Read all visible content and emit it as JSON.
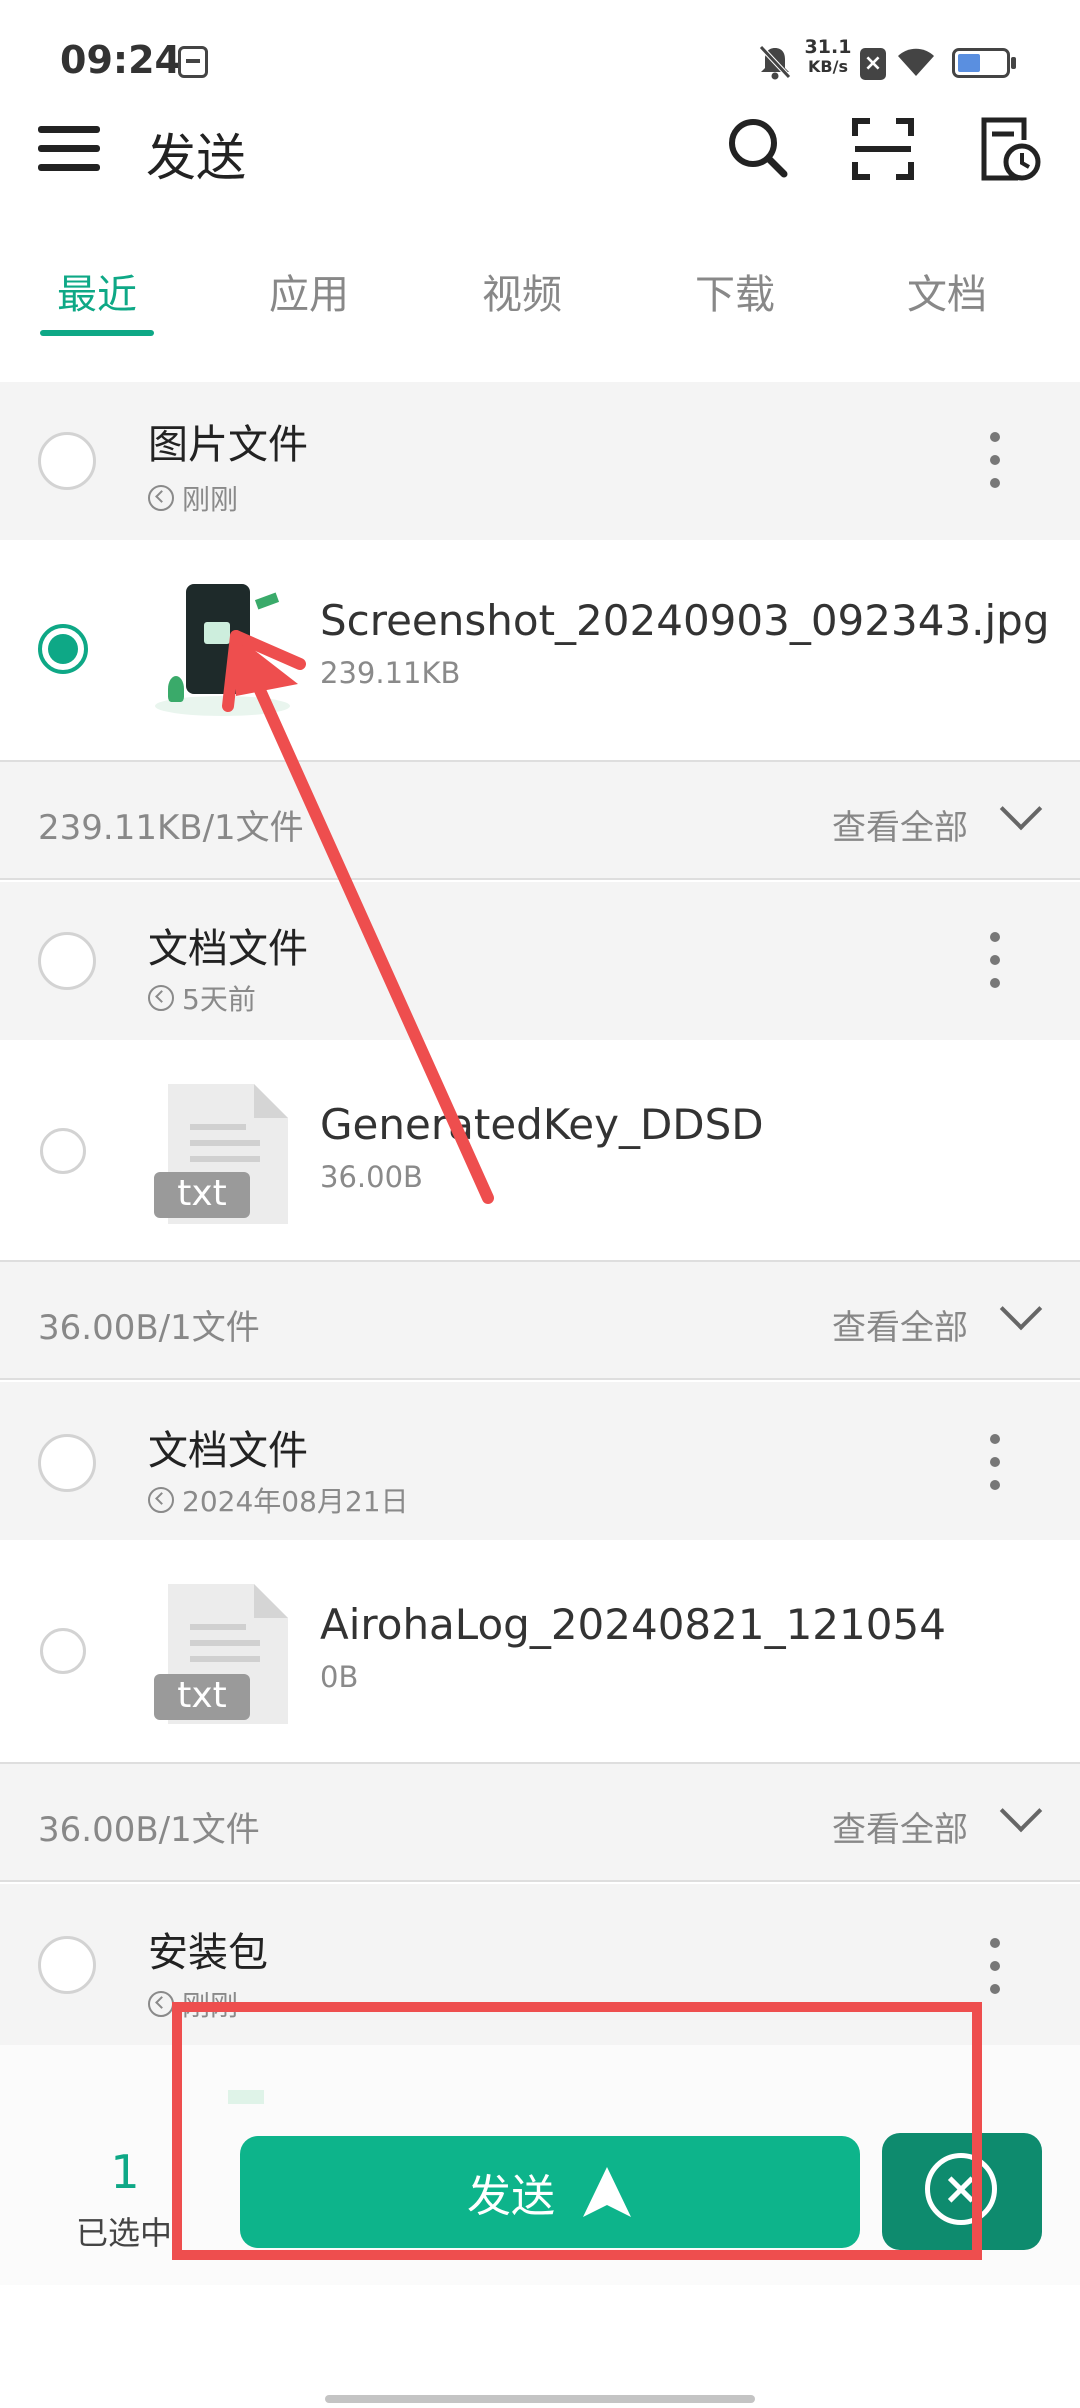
{
  "status_bar": {
    "time": "09:24",
    "net_speed_value": "31.1",
    "net_speed_unit": "KB/s"
  },
  "app_bar": {
    "title": "发送",
    "icons": [
      "menu-icon",
      "search-icon",
      "scan-icon",
      "history-icon"
    ]
  },
  "tabs": [
    {
      "label": "最近",
      "active": true
    },
    {
      "label": "应用",
      "active": false
    },
    {
      "label": "视频",
      "active": false
    },
    {
      "label": "下载",
      "active": false
    },
    {
      "label": "文档",
      "active": false
    }
  ],
  "sections": [
    {
      "title": "图片文件",
      "time": "刚刚",
      "file": {
        "name": "Screenshot_20240903_092343.jpg",
        "size": "239.11KB",
        "selected": true
      },
      "summary": "239.11KB/1文件",
      "view_all": "查看全部"
    },
    {
      "title": "文档文件",
      "time": "5天前",
      "file": {
        "name": "GeneratedKey_DDSD",
        "size": "36.00B",
        "badge": "txt",
        "selected": false
      },
      "summary": "36.00B/1文件",
      "view_all": "查看全部"
    },
    {
      "title": "文档文件",
      "time": "2024年08月21日",
      "file": {
        "name": "AirohaLog_20240821_121054",
        "size": "0B",
        "badge": "txt",
        "selected": false
      },
      "summary": "36.00B/1文件",
      "view_all": "查看全部"
    },
    {
      "title": "安装包",
      "time": "刚刚"
    }
  ],
  "bottom_bar": {
    "selected_count": "1",
    "selected_label": "已选中",
    "send_label": "发送"
  },
  "colors": {
    "accent": "#0ea886",
    "send_button": "#0db48b",
    "close_button": "#0e8b6e",
    "annotation": "#ee4e4e"
  }
}
